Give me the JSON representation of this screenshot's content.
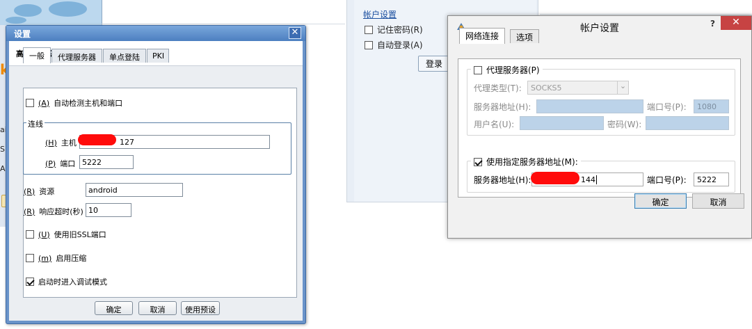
{
  "background": {
    "left_fragments": [
      "k",
      "ai.c",
      "S)",
      "A)"
    ],
    "panel": {
      "link": "帐户设置",
      "remember_password": "记住密码(R)",
      "auto_login": "自动登录(A)",
      "login_button": "登录"
    }
  },
  "settings_dialog": {
    "title": "设置",
    "close_glyph": "✕",
    "header": "高级连接设置",
    "tabs": [
      "一般",
      "代理服务器",
      "单点登陆",
      "PKI"
    ],
    "auto_detect": {
      "label": "自动检测主机和端口",
      "mnemonic": "(A)",
      "checked": false
    },
    "group_title": "连线",
    "host": {
      "mnemonic": "(H)",
      "label": "主机",
      "value": "127"
    },
    "port": {
      "mnemonic": "(P)",
      "label": "端口",
      "value": "5222"
    },
    "resource": {
      "mnemonic": "(R)",
      "label": "资源",
      "value": "android"
    },
    "timeout": {
      "mnemonic": "(R)",
      "label": "响应超时(秒)",
      "value": "10"
    },
    "old_ssl": {
      "mnemonic": "(U)",
      "label": "使用旧SSL端口",
      "checked": false
    },
    "compression": {
      "mnemonic": "(m)",
      "label": "启用压缩",
      "checked": false
    },
    "debug_mode": {
      "label": "启动时进入调试模式",
      "checked": true
    },
    "buttons": {
      "ok": "确定",
      "cancel": "取消",
      "defaults": "使用预设"
    }
  },
  "account_dialog": {
    "title": "帐户设置",
    "help_glyph": "?",
    "close_glyph": "✕",
    "tabs": [
      "网络连接",
      "选项"
    ],
    "proxy": {
      "enabled_label": "代理服务器(P)",
      "checked": false,
      "type_label": "代理类型(T):",
      "type_value": "SOCKS5",
      "server_label": "服务器地址(H):",
      "server_value": "",
      "port_label": "端口号(P):",
      "port_value": "1080",
      "user_label": "用户名(U):",
      "user_value": "",
      "password_label": "密码(W):",
      "password_value": ""
    },
    "custom_server": {
      "enabled_label": "使用指定服务器地址(M):",
      "checked": true,
      "server_label": "服务器地址(H):",
      "server_value": "144",
      "port_label": "端口号(P):",
      "port_value": "5222"
    },
    "buttons": {
      "ok": "确定",
      "cancel": "取消"
    }
  },
  "colors": {
    "redaction": "#ff0b0b",
    "title_blue": "#4c7fc0",
    "close_red": "#c74343"
  }
}
